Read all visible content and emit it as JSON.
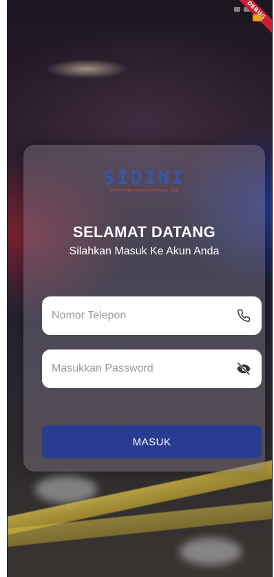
{
  "status_bar": {
    "time": ""
  },
  "debug": {
    "ribbon": "DEBUG",
    "badge": ""
  },
  "logo": {
    "word": "SIDINI",
    "tagline": "SISTEM INFORMASI DETEKSI DINI"
  },
  "login": {
    "title": "SELAMAT DATANG",
    "subtitle": "Silahkan Masuk Ke Akun Anda",
    "phone_placeholder": "Nomor Telepon",
    "password_placeholder": "Masukkan Password",
    "submit_label": "MASUK"
  },
  "icons": {
    "phone": "phone-icon",
    "password_toggle": "eye-off-icon"
  },
  "colors": {
    "button": "#2a3c92",
    "logo_blue": "#3857a8",
    "logo_tagline": "#d8443a",
    "card": "rgba(135,125,140,0.42)"
  }
}
